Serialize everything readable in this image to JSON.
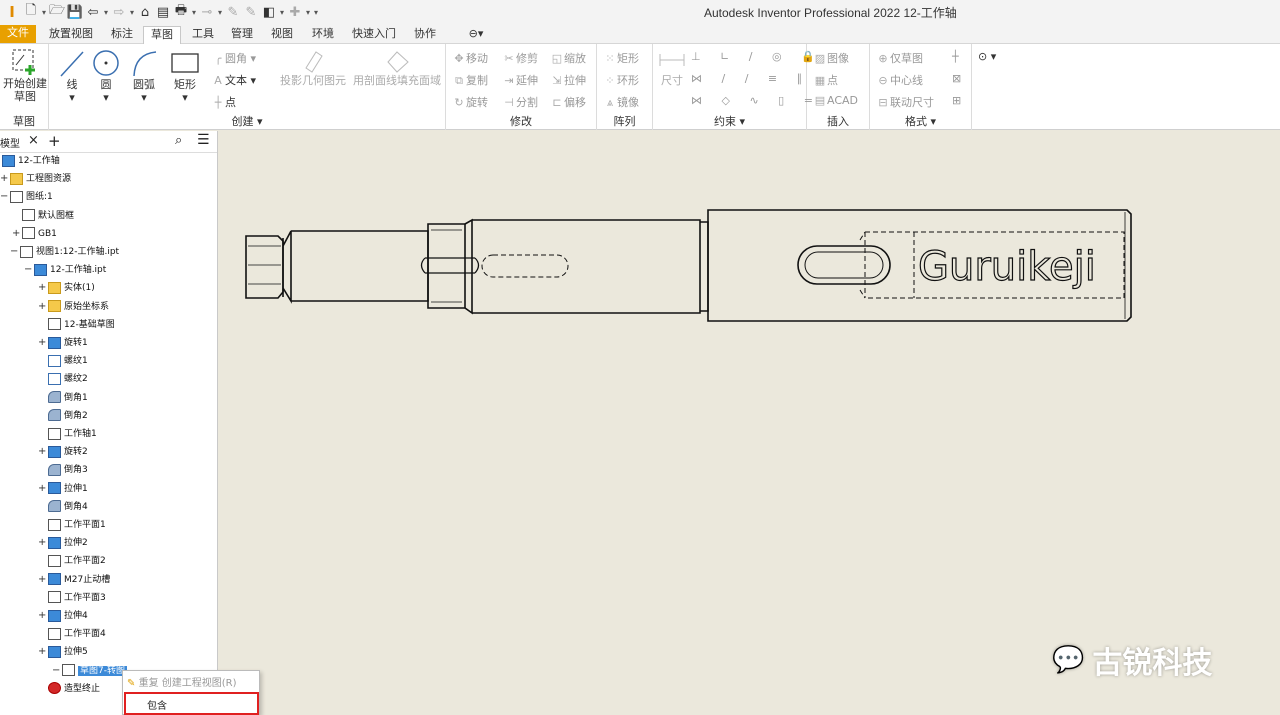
{
  "title": "Autodesk Inventor Professional 2022    12-工作轴",
  "tabs": [
    "文件",
    "放置视图",
    "标注",
    "草图",
    "工具",
    "管理",
    "视图",
    "环境",
    "快速入门",
    "协作"
  ],
  "ribbon": {
    "sketch": {
      "start_label": "开始创建\n草图",
      "panel": "草图"
    },
    "create": {
      "line": "线",
      "circle": "圆",
      "arc": "圆弧",
      "rect": "矩形",
      "fillet": "圆角",
      "text": "文本",
      "point": "点",
      "project": "投影几何图元",
      "fill": "用剖面线填充面域",
      "panel": "创建"
    },
    "modify": {
      "move": "移动",
      "trim": "修剪",
      "scale": "缩放",
      "copy": "复制",
      "extend": "延伸",
      "stretch": "拉伸",
      "rotate": "旋转",
      "split": "分割",
      "offset": "偏移",
      "panel": "修改"
    },
    "pattern": {
      "rect": "矩形",
      "circ": "环形",
      "mirror": "镜像",
      "panel": "阵列"
    },
    "constrain": {
      "dim": "尺寸",
      "panel": "约束"
    },
    "insert": {
      "image": "图像",
      "point": "点",
      "acad": "ACAD",
      "panel": "插入"
    },
    "format": {
      "sketch_only": "仅草图",
      "centerline": "中心线",
      "driven": "联动尺寸",
      "panel": "格式"
    }
  },
  "browser": {
    "tab": "模型",
    "rows": [
      "12-工作轴",
      "工程图资源",
      "图纸:1",
      "默认图框",
      "GB1",
      "视图1:12-工作轴.ipt",
      "12-工作轴.ipt",
      "实体(1)",
      "原始坐标系",
      "12-基础草图",
      "旋转1",
      "螺纹1",
      "螺纹2",
      "倒角1",
      "倒角2",
      "工作轴1",
      "旋转2",
      "倒角3",
      "拉伸1",
      "倒角4",
      "工作平面1",
      "拉伸2",
      "工作平面2",
      "M27止动槽",
      "工作平面3",
      "拉伸4",
      "工作平面4",
      "拉伸5",
      "草图7-转图",
      "造型终止"
    ]
  },
  "context_menu": {
    "items": [
      "重复 创建工程视图(R)",
      "包含"
    ]
  },
  "drawing": {
    "text": "Guruikeji"
  },
  "watermark": "古锐科技"
}
